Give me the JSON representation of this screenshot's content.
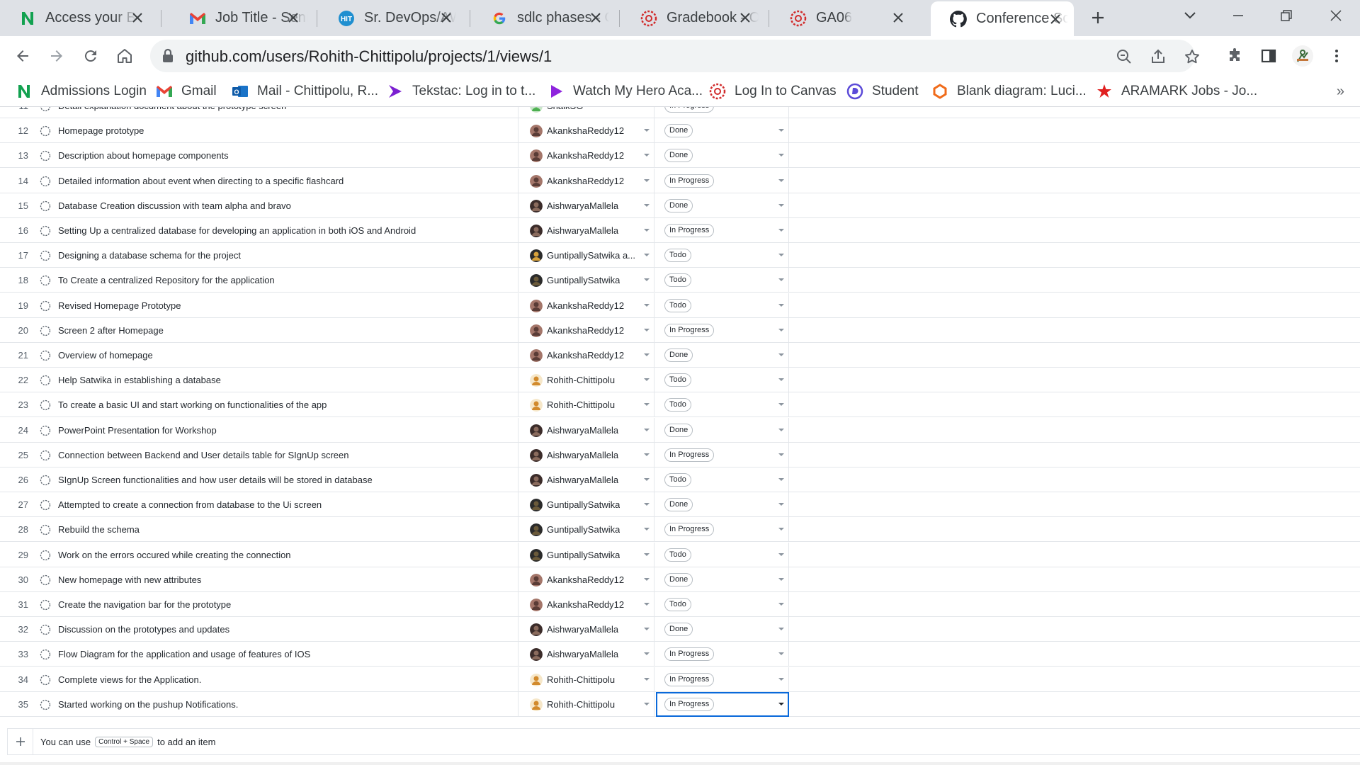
{
  "colors": {
    "tabstrip_bg": "#dee1e6",
    "omnibox_bg": "#f1f3f4",
    "selection_blue": "#0969da",
    "notion_green": "#12a150"
  },
  "tabs": [
    {
      "title": "Access your Be",
      "icon": "notion-icon",
      "active": false
    },
    {
      "title": "Job Title - Seni",
      "icon": "gmail-icon",
      "active": false
    },
    {
      "title": "Sr. DevOps/AW",
      "icon": "hit-icon",
      "active": false
    },
    {
      "title": "sdlc phases - G",
      "icon": "google-icon",
      "active": false
    },
    {
      "title": "Gradebook - O",
      "icon": "canvas-icon",
      "active": false
    },
    {
      "title": "GA06",
      "icon": "canvas-icon",
      "active": false
    },
    {
      "title": "Conference Sc",
      "icon": "github-icon",
      "active": true
    }
  ],
  "toolbar": {
    "url": "github.com/users/Rohith-Chittipolu/projects/1/views/1"
  },
  "bookmarks": [
    {
      "label": "Admissions Login",
      "icon": "notion-icon"
    },
    {
      "label": "Gmail",
      "icon": "gmail-icon"
    },
    {
      "label": "Mail - Chittipolu, R...",
      "icon": "outlook-icon"
    },
    {
      "label": "Tekstac: Log in to t...",
      "icon": "tekstac-icon"
    },
    {
      "label": "Watch My Hero Aca...",
      "icon": "play-icon"
    },
    {
      "label": "Log In to Canvas",
      "icon": "canvas-icon"
    },
    {
      "label": "Student",
      "icon": "student-icon"
    },
    {
      "label": "Blank diagram: Luci...",
      "icon": "lucid-icon"
    },
    {
      "label": "ARAMARK Jobs - Jo...",
      "icon": "aramark-icon"
    }
  ],
  "bookmarks_more": "»",
  "rows": [
    {
      "num": "11",
      "title": "Detail explanation document about the prototype screen",
      "assignee": "ShaikSG",
      "status": "In Progress"
    },
    {
      "num": "12",
      "title": "Homepage prototype",
      "assignee": "AkankshaReddy12",
      "status": "Done"
    },
    {
      "num": "13",
      "title": "Description about homepage components",
      "assignee": "AkankshaReddy12",
      "status": "Done"
    },
    {
      "num": "14",
      "title": "Detailed information about event when directing to a specific flashcard",
      "assignee": "AkankshaReddy12",
      "status": "In Progress"
    },
    {
      "num": "15",
      "title": "Database Creation discussion with team alpha and bravo",
      "assignee": "AishwaryaMallela",
      "status": "Done"
    },
    {
      "num": "16",
      "title": "Setting Up a centralized database for developing an application in both iOS and Android",
      "assignee": "AishwaryaMallela",
      "status": "In Progress"
    },
    {
      "num": "17",
      "title": "Designing a database schema for the project",
      "assignee": "GuntipallySatwika a...",
      "status": "Todo"
    },
    {
      "num": "18",
      "title": "To Create a centralized Repository for the application",
      "assignee": "GuntipallySatwika",
      "status": "Todo"
    },
    {
      "num": "19",
      "title": "Revised Homepage Prototype",
      "assignee": "AkankshaReddy12",
      "status": "Todo"
    },
    {
      "num": "20",
      "title": "Screen 2 after Homepage",
      "assignee": "AkankshaReddy12",
      "status": "In Progress"
    },
    {
      "num": "21",
      "title": "Overview of homepage",
      "assignee": "AkankshaReddy12",
      "status": "Done"
    },
    {
      "num": "22",
      "title": "Help Satwika in establishing a database",
      "assignee": "Rohith-Chittipolu",
      "status": "Todo"
    },
    {
      "num": "23",
      "title": "To create a basic UI and start working on functionalities of the app",
      "assignee": "Rohith-Chittipolu",
      "status": "Todo"
    },
    {
      "num": "24",
      "title": "PowerPoint Presentation for Workshop",
      "assignee": "AishwaryaMallela",
      "status": "Done"
    },
    {
      "num": "25",
      "title": "Connection between Backend and User details table for SIgnUp screen",
      "assignee": "AishwaryaMallela",
      "status": "In Progress"
    },
    {
      "num": "26",
      "title": "SIgnUp Screen functionalities and how user details will be stored in database",
      "assignee": "AishwaryaMallela",
      "status": "Todo"
    },
    {
      "num": "27",
      "title": "Attempted to create a connection from database to the Ui screen",
      "assignee": "GuntipallySatwika",
      "status": "Done"
    },
    {
      "num": "28",
      "title": "Rebuild the schema",
      "assignee": "GuntipallySatwika",
      "status": "In Progress"
    },
    {
      "num": "29",
      "title": "Work on the errors occured while creating the connection",
      "assignee": "GuntipallySatwika",
      "status": "Todo"
    },
    {
      "num": "30",
      "title": "New homepage with new attributes",
      "assignee": "AkankshaReddy12",
      "status": "Done"
    },
    {
      "num": "31",
      "title": "Create the navigation bar for the prototype",
      "assignee": "AkankshaReddy12",
      "status": "Todo"
    },
    {
      "num": "32",
      "title": "Discussion on the prototypes and updates",
      "assignee": "AishwaryaMallela",
      "status": "Done"
    },
    {
      "num": "33",
      "title": "Flow Diagram for the application and usage of features of IOS",
      "assignee": "AishwaryaMallela",
      "status": "In Progress"
    },
    {
      "num": "34",
      "title": "Complete views for the Application.",
      "assignee": "Rohith-Chittipolu",
      "status": "In Progress"
    },
    {
      "num": "35",
      "title": "Started working on the pushup Notifications.",
      "assignee": "Rohith-Chittipolu",
      "status": "In Progress",
      "selected": true
    }
  ],
  "add_item": {
    "prefix": "You can use",
    "shortcut": "Control + Space",
    "suffix": "to add an item"
  }
}
